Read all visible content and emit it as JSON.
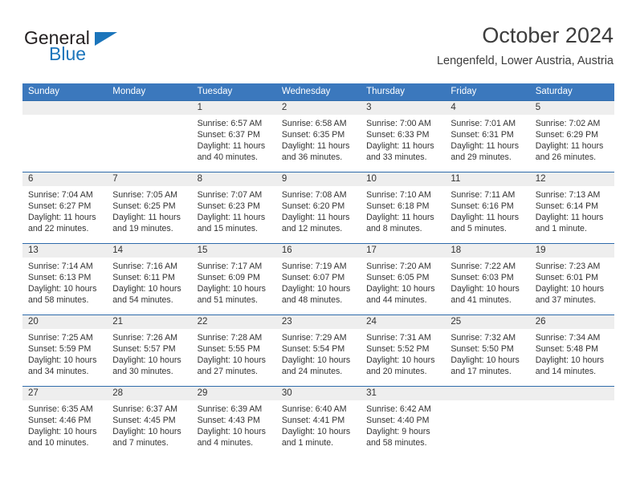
{
  "brand": {
    "name_top": "General",
    "name_bottom": "Blue",
    "accent_color": "#1b75bb"
  },
  "header": {
    "title": "October 2024",
    "subtitle": "Lengenfeld, Lower Austria, Austria"
  },
  "theme": {
    "header_blue": "#3b78bd",
    "row_divider_blue": "#2f6bab",
    "daynum_band_gray": "#eeeeee"
  },
  "weekdays": [
    "Sunday",
    "Monday",
    "Tuesday",
    "Wednesday",
    "Thursday",
    "Friday",
    "Saturday"
  ],
  "weeks": [
    [
      {
        "day": "",
        "sunrise": "",
        "sunset": "",
        "daylight": ""
      },
      {
        "day": "",
        "sunrise": "",
        "sunset": "",
        "daylight": ""
      },
      {
        "day": "1",
        "sunrise": "Sunrise: 6:57 AM",
        "sunset": "Sunset: 6:37 PM",
        "daylight": "Daylight: 11 hours and 40 minutes."
      },
      {
        "day": "2",
        "sunrise": "Sunrise: 6:58 AM",
        "sunset": "Sunset: 6:35 PM",
        "daylight": "Daylight: 11 hours and 36 minutes."
      },
      {
        "day": "3",
        "sunrise": "Sunrise: 7:00 AM",
        "sunset": "Sunset: 6:33 PM",
        "daylight": "Daylight: 11 hours and 33 minutes."
      },
      {
        "day": "4",
        "sunrise": "Sunrise: 7:01 AM",
        "sunset": "Sunset: 6:31 PM",
        "daylight": "Daylight: 11 hours and 29 minutes."
      },
      {
        "day": "5",
        "sunrise": "Sunrise: 7:02 AM",
        "sunset": "Sunset: 6:29 PM",
        "daylight": "Daylight: 11 hours and 26 minutes."
      }
    ],
    [
      {
        "day": "6",
        "sunrise": "Sunrise: 7:04 AM",
        "sunset": "Sunset: 6:27 PM",
        "daylight": "Daylight: 11 hours and 22 minutes."
      },
      {
        "day": "7",
        "sunrise": "Sunrise: 7:05 AM",
        "sunset": "Sunset: 6:25 PM",
        "daylight": "Daylight: 11 hours and 19 minutes."
      },
      {
        "day": "8",
        "sunrise": "Sunrise: 7:07 AM",
        "sunset": "Sunset: 6:23 PM",
        "daylight": "Daylight: 11 hours and 15 minutes."
      },
      {
        "day": "9",
        "sunrise": "Sunrise: 7:08 AM",
        "sunset": "Sunset: 6:20 PM",
        "daylight": "Daylight: 11 hours and 12 minutes."
      },
      {
        "day": "10",
        "sunrise": "Sunrise: 7:10 AM",
        "sunset": "Sunset: 6:18 PM",
        "daylight": "Daylight: 11 hours and 8 minutes."
      },
      {
        "day": "11",
        "sunrise": "Sunrise: 7:11 AM",
        "sunset": "Sunset: 6:16 PM",
        "daylight": "Daylight: 11 hours and 5 minutes."
      },
      {
        "day": "12",
        "sunrise": "Sunrise: 7:13 AM",
        "sunset": "Sunset: 6:14 PM",
        "daylight": "Daylight: 11 hours and 1 minute."
      }
    ],
    [
      {
        "day": "13",
        "sunrise": "Sunrise: 7:14 AM",
        "sunset": "Sunset: 6:13 PM",
        "daylight": "Daylight: 10 hours and 58 minutes."
      },
      {
        "day": "14",
        "sunrise": "Sunrise: 7:16 AM",
        "sunset": "Sunset: 6:11 PM",
        "daylight": "Daylight: 10 hours and 54 minutes."
      },
      {
        "day": "15",
        "sunrise": "Sunrise: 7:17 AM",
        "sunset": "Sunset: 6:09 PM",
        "daylight": "Daylight: 10 hours and 51 minutes."
      },
      {
        "day": "16",
        "sunrise": "Sunrise: 7:19 AM",
        "sunset": "Sunset: 6:07 PM",
        "daylight": "Daylight: 10 hours and 48 minutes."
      },
      {
        "day": "17",
        "sunrise": "Sunrise: 7:20 AM",
        "sunset": "Sunset: 6:05 PM",
        "daylight": "Daylight: 10 hours and 44 minutes."
      },
      {
        "day": "18",
        "sunrise": "Sunrise: 7:22 AM",
        "sunset": "Sunset: 6:03 PM",
        "daylight": "Daylight: 10 hours and 41 minutes."
      },
      {
        "day": "19",
        "sunrise": "Sunrise: 7:23 AM",
        "sunset": "Sunset: 6:01 PM",
        "daylight": "Daylight: 10 hours and 37 minutes."
      }
    ],
    [
      {
        "day": "20",
        "sunrise": "Sunrise: 7:25 AM",
        "sunset": "Sunset: 5:59 PM",
        "daylight": "Daylight: 10 hours and 34 minutes."
      },
      {
        "day": "21",
        "sunrise": "Sunrise: 7:26 AM",
        "sunset": "Sunset: 5:57 PM",
        "daylight": "Daylight: 10 hours and 30 minutes."
      },
      {
        "day": "22",
        "sunrise": "Sunrise: 7:28 AM",
        "sunset": "Sunset: 5:55 PM",
        "daylight": "Daylight: 10 hours and 27 minutes."
      },
      {
        "day": "23",
        "sunrise": "Sunrise: 7:29 AM",
        "sunset": "Sunset: 5:54 PM",
        "daylight": "Daylight: 10 hours and 24 minutes."
      },
      {
        "day": "24",
        "sunrise": "Sunrise: 7:31 AM",
        "sunset": "Sunset: 5:52 PM",
        "daylight": "Daylight: 10 hours and 20 minutes."
      },
      {
        "day": "25",
        "sunrise": "Sunrise: 7:32 AM",
        "sunset": "Sunset: 5:50 PM",
        "daylight": "Daylight: 10 hours and 17 minutes."
      },
      {
        "day": "26",
        "sunrise": "Sunrise: 7:34 AM",
        "sunset": "Sunset: 5:48 PM",
        "daylight": "Daylight: 10 hours and 14 minutes."
      }
    ],
    [
      {
        "day": "27",
        "sunrise": "Sunrise: 6:35 AM",
        "sunset": "Sunset: 4:46 PM",
        "daylight": "Daylight: 10 hours and 10 minutes."
      },
      {
        "day": "28",
        "sunrise": "Sunrise: 6:37 AM",
        "sunset": "Sunset: 4:45 PM",
        "daylight": "Daylight: 10 hours and 7 minutes."
      },
      {
        "day": "29",
        "sunrise": "Sunrise: 6:39 AM",
        "sunset": "Sunset: 4:43 PM",
        "daylight": "Daylight: 10 hours and 4 minutes."
      },
      {
        "day": "30",
        "sunrise": "Sunrise: 6:40 AM",
        "sunset": "Sunset: 4:41 PM",
        "daylight": "Daylight: 10 hours and 1 minute."
      },
      {
        "day": "31",
        "sunrise": "Sunrise: 6:42 AM",
        "sunset": "Sunset: 4:40 PM",
        "daylight": "Daylight: 9 hours and 58 minutes."
      },
      {
        "day": "",
        "sunrise": "",
        "sunset": "",
        "daylight": ""
      },
      {
        "day": "",
        "sunrise": "",
        "sunset": "",
        "daylight": ""
      }
    ]
  ]
}
